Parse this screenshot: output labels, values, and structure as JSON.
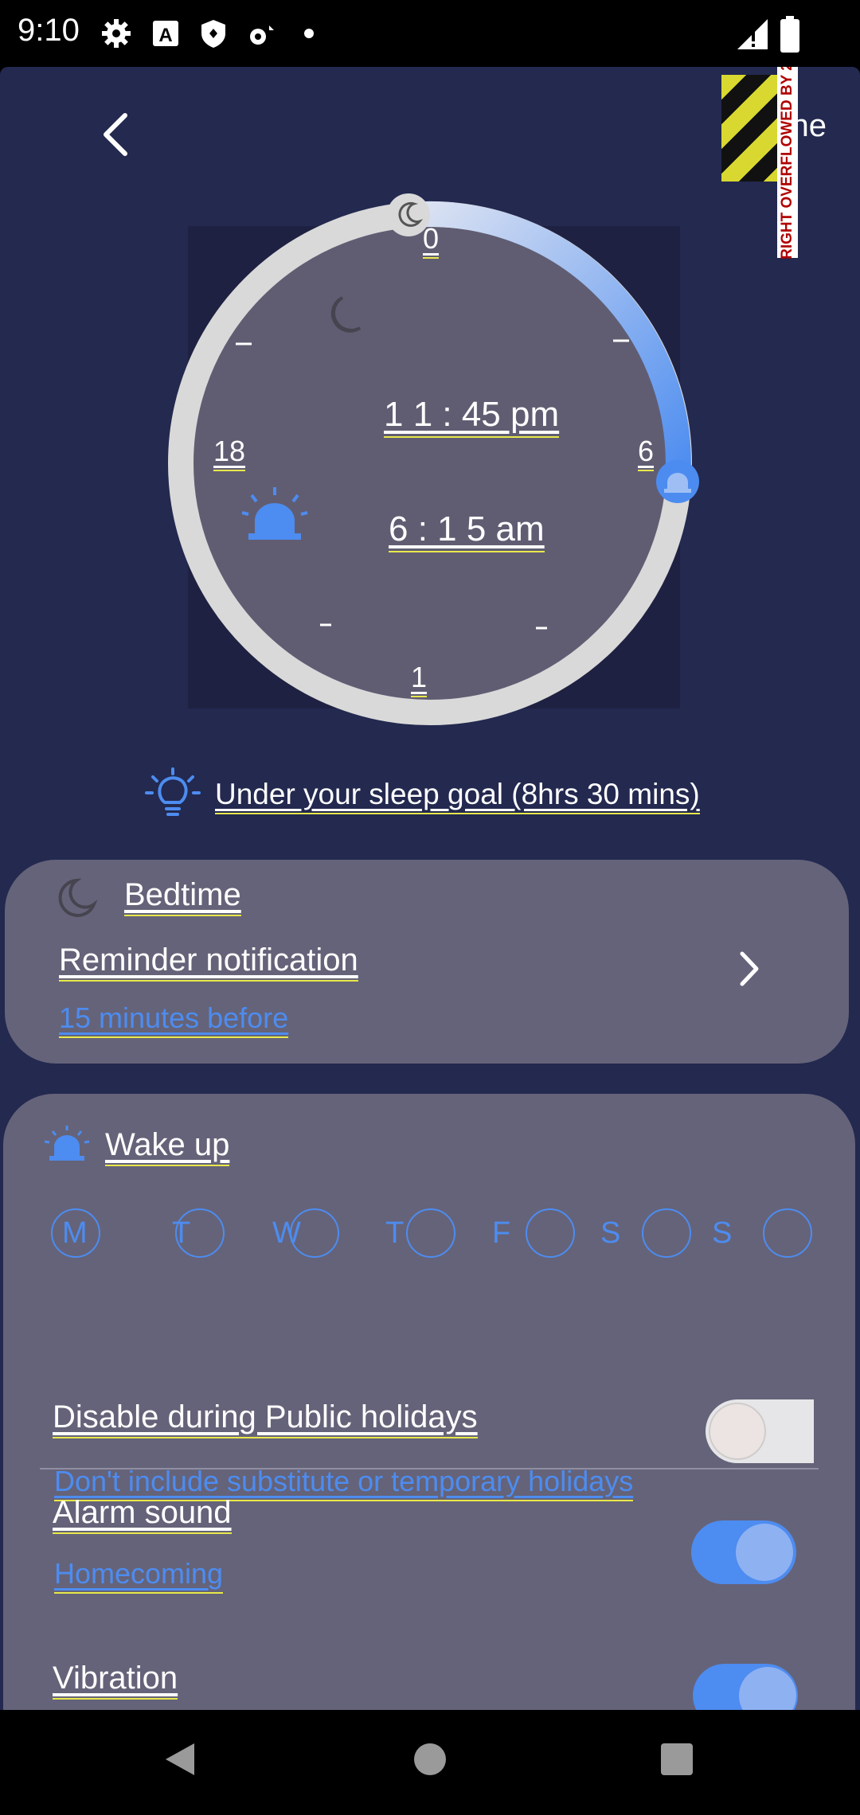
{
  "status_bar": {
    "time": "9:10",
    "left_icons": [
      "gear-icon",
      "a-badge-icon",
      "shield-icon",
      "fan-icon",
      "dot-icon"
    ],
    "right_icons": [
      "signal-icon",
      "battery-icon"
    ]
  },
  "header": {
    "back_label": "<",
    "done_label": "Done",
    "overflow_warning": "RIGHT OVERFLOWED BY 2"
  },
  "dial": {
    "labels": {
      "top": "0",
      "right": "6",
      "left": "18",
      "bottom": "1"
    },
    "bedtime": "1 1 : 45 pm",
    "wake_time": "6 : 1 5 am",
    "arc_color": "#5a93ee",
    "track_color": "#d9d9d9",
    "face_color": "#605d73"
  },
  "sleep_goal": {
    "text": "Under your sleep goal (8hrs 30 mins)",
    "icon": "lightbulb-icon"
  },
  "bedtime_card": {
    "title": "Bedtime",
    "reminder_label": "Reminder notification",
    "reminder_value": "15 minutes before"
  },
  "wakeup_card": {
    "title": "Wake up",
    "days": [
      "M",
      "T",
      "W",
      "T",
      "F",
      "S",
      "S"
    ],
    "holidays_label": "Disable during Public holidays",
    "holidays_sub": "Don't include substitute or temporary holidays",
    "holidays_enabled": false,
    "alarm_label": "Alarm sound",
    "alarm_value": "Homecoming",
    "alarm_enabled": true,
    "vibration_label": "Vibration",
    "vibration_enabled": true
  },
  "colors": {
    "background": "#23294f",
    "card": "#656379",
    "accent": "#4d8cf0"
  }
}
